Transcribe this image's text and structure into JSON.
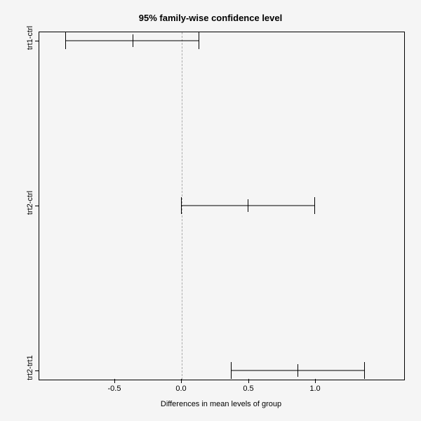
{
  "title": "95% family-wise confidence level",
  "xlabel": "Differences in mean levels of group",
  "chart_data": {
    "type": "bar",
    "xlim": [
      -1.0,
      1.5
    ],
    "xticks": [
      -0.5,
      0.0,
      0.5,
      1.0
    ],
    "xticklabels": [
      "-0.5",
      "0.0",
      "0.5",
      "1.0"
    ],
    "y_categories": [
      "trt1-ctrl",
      "trt2-ctrl",
      "trt2-trt1"
    ],
    "series": [
      {
        "name": "trt1-ctrl",
        "lwr": -0.87,
        "diff": -0.37,
        "upr": 0.13
      },
      {
        "name": "trt2-ctrl",
        "lwr": -0.006,
        "diff": 0.494,
        "upr": 0.994
      },
      {
        "name": "trt2-trt1",
        "lwr": 0.365,
        "diff": 0.865,
        "upr": 1.365
      }
    ],
    "reference_line": 0.0
  }
}
